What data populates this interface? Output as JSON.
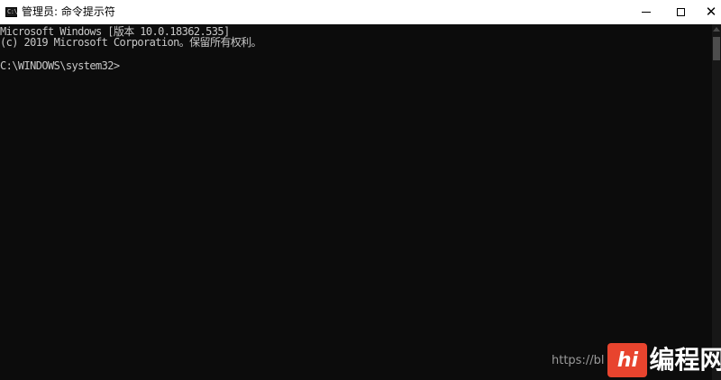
{
  "window": {
    "title": "管理员: 命令提示符",
    "icon": "cmd-icon",
    "icon_text": "C:\\",
    "controls": {
      "minimize": "─",
      "maximize": "□",
      "close": "✕"
    }
  },
  "console": {
    "lines": [
      "Microsoft Windows [版本 10.0.18362.535]",
      "(c) 2019 Microsoft Corporation。保留所有权利。",
      "C:\\WINDOWS\\system32>"
    ],
    "text_color": "#c8c8c8",
    "background": "#0c0c0c"
  },
  "watermark": {
    "url_text": "https://bl",
    "logo_text": "hi",
    "site_text": "编程网",
    "logo_color": "#e8442e"
  }
}
